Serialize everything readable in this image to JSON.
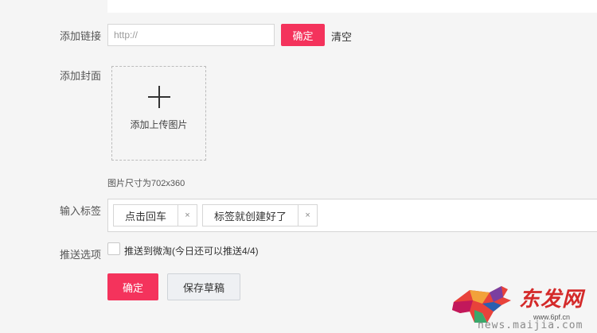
{
  "top_panel": {},
  "link": {
    "label": "添加链接",
    "placeholder": "http://",
    "value": "",
    "confirm_label": "确定",
    "clear_label": "清空"
  },
  "cover": {
    "label": "添加封面",
    "upload_text": "添加上传图片",
    "size_hint": "图片尺寸为702x360"
  },
  "tags": {
    "label": "输入标签",
    "items": [
      {
        "text": "点击回车"
      },
      {
        "text": "标签就创建好了"
      }
    ],
    "close_glyph": "×"
  },
  "push": {
    "label": "推送选项",
    "checkbox_text": "推送到微淘(今日还可以推送4/4)",
    "checked": false
  },
  "actions": {
    "confirm_label": "确定",
    "draft_label": "保存草稿"
  },
  "watermark": {
    "brand": "东发网",
    "small": "www.6pf.cn",
    "url": "news.maijia.com"
  },
  "colors": {
    "accent": "#f4335c",
    "background": "#f5f5f5",
    "border": "#d6d6d6"
  }
}
